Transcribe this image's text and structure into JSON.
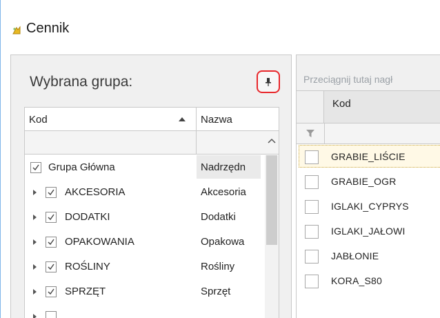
{
  "window": {
    "title": "Cennik"
  },
  "left_panel": {
    "group_label": "Wybrana grupa:",
    "columns": {
      "code": "Kod",
      "name": "Nazwa"
    },
    "rows": [
      {
        "code": "Grupa Główna",
        "name": "Nadrzędn",
        "checked": true,
        "expandable": false
      },
      {
        "code": "AKCESORIA",
        "name": "Akcesoria",
        "checked": true,
        "expandable": true
      },
      {
        "code": "DODATKI",
        "name": "Dodatki",
        "checked": true,
        "expandable": true
      },
      {
        "code": "OPAKOWANIA",
        "name": "Opakowa",
        "checked": true,
        "expandable": true
      },
      {
        "code": "ROŚLINY",
        "name": "Rośliny",
        "checked": true,
        "expandable": true
      },
      {
        "code": "SPRZĘT",
        "name": "Sprzęt",
        "checked": true,
        "expandable": true
      }
    ]
  },
  "right_panel": {
    "drag_hint": "Przeciągnij tutaj nagł",
    "columns": {
      "code": "Kod"
    },
    "rows": [
      {
        "code": "GRABIE_LIŚCIE",
        "selected": true
      },
      {
        "code": "GRABIE_OGR",
        "selected": false
      },
      {
        "code": "IGLAKI_CYPRYS",
        "selected": false
      },
      {
        "code": "IGLAKI_JAŁOWI",
        "selected": false
      },
      {
        "code": "JABŁONIE",
        "selected": false
      },
      {
        "code": "KORA_S80",
        "selected": false
      }
    ]
  },
  "colors": {
    "pin_highlight": "#e8262a",
    "window_border": "#7eb4ea",
    "selection": "#fff9e6"
  }
}
